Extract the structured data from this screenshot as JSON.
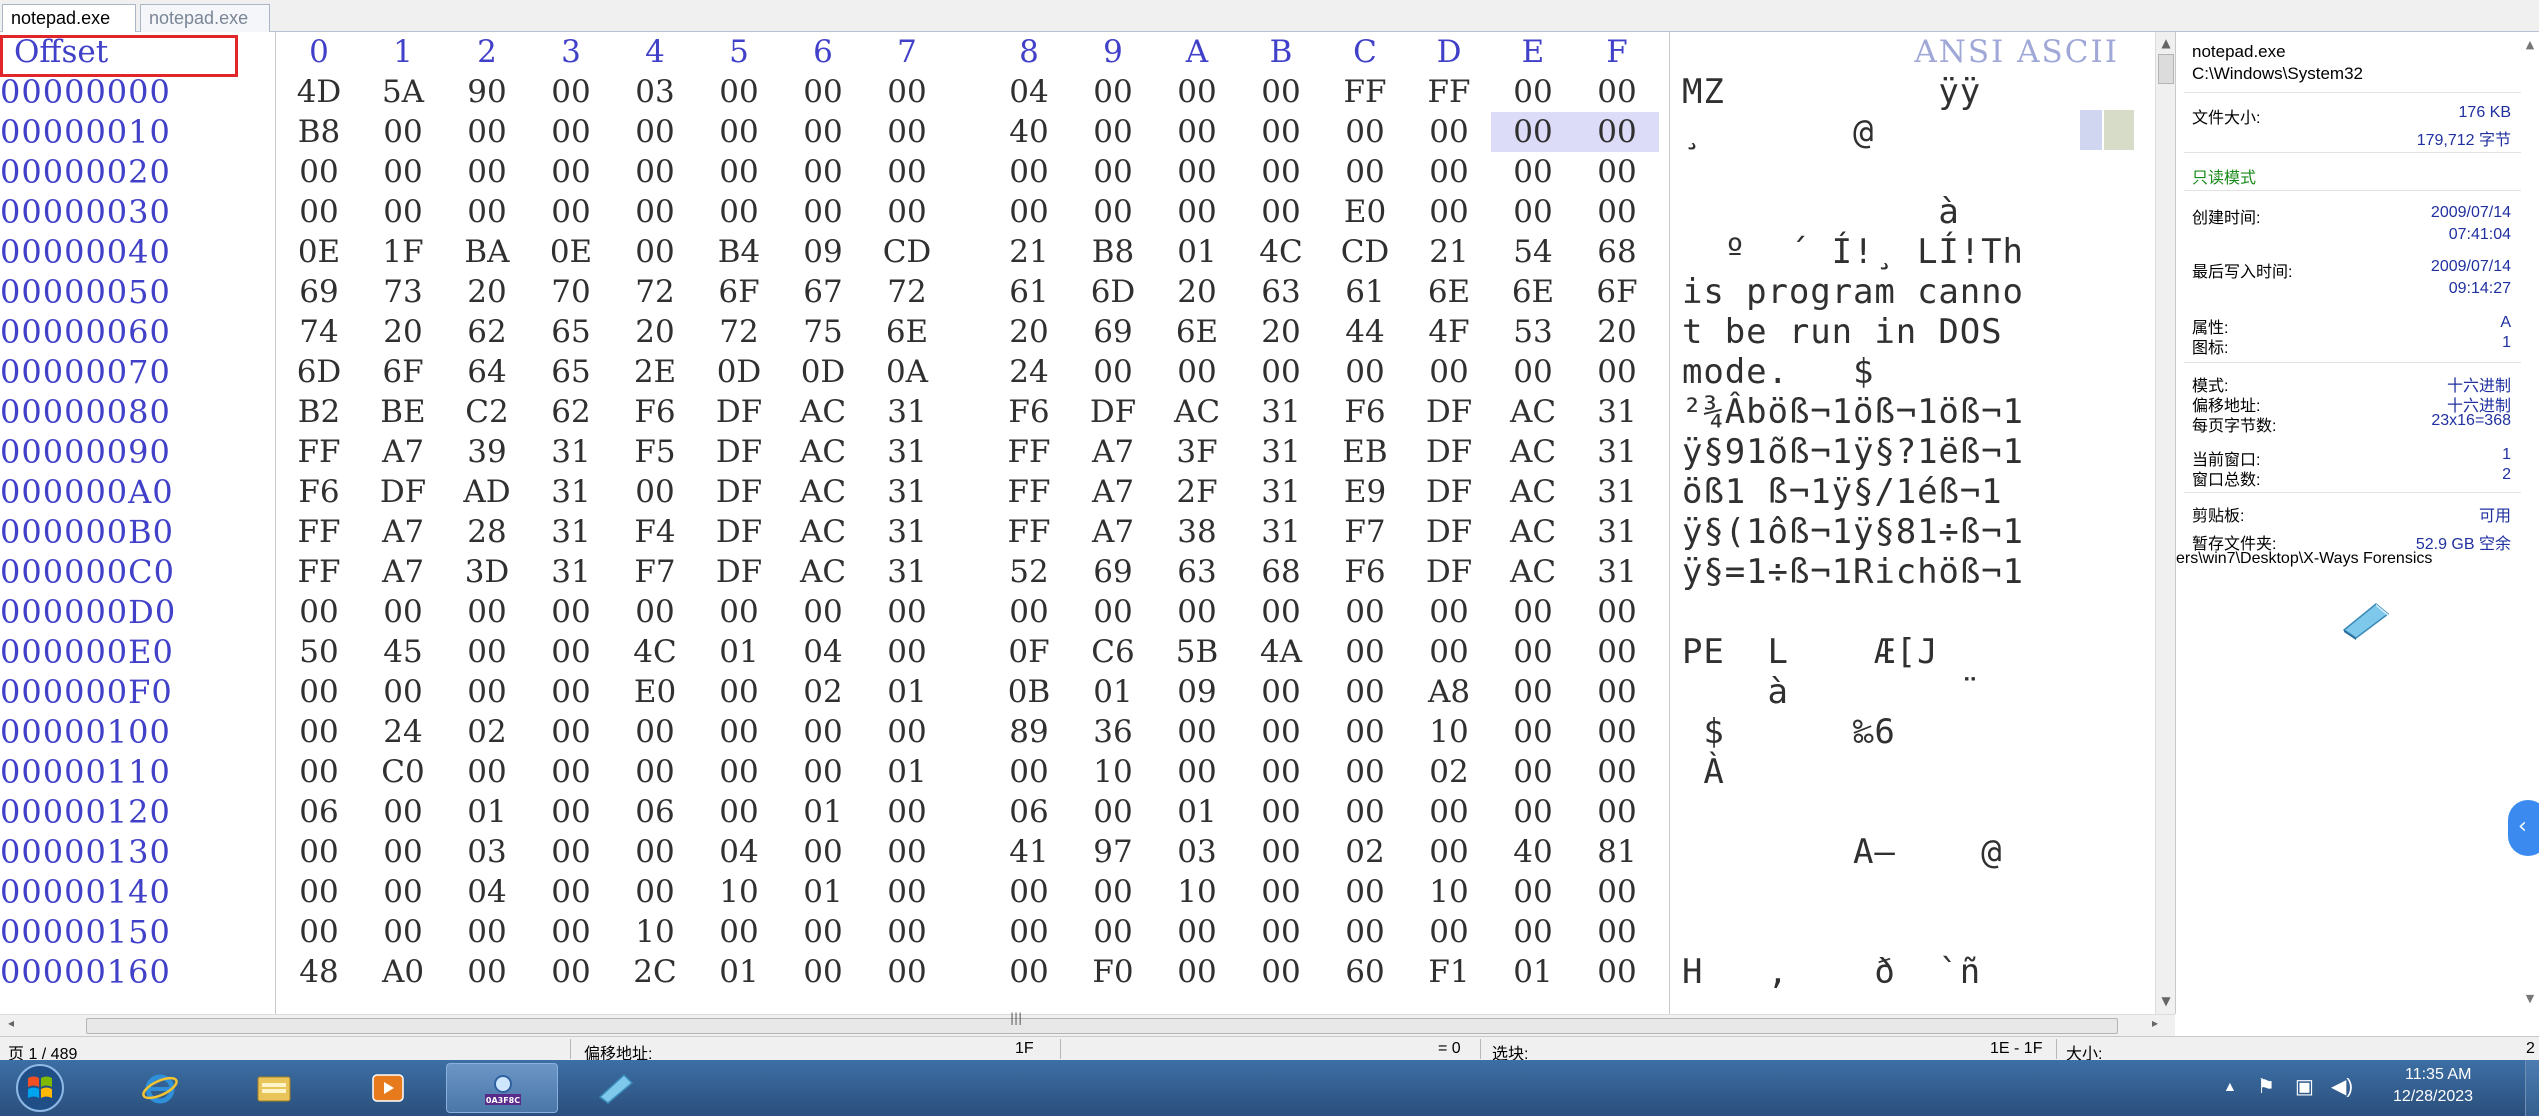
{
  "tabs": [
    {
      "label": "notepad.exe",
      "active": true
    },
    {
      "label": "notepad.exe",
      "active": false
    }
  ],
  "hex_header": {
    "offset_label": "Offset",
    "columns": [
      "0",
      "1",
      "2",
      "3",
      "4",
      "5",
      "6",
      "7",
      "8",
      "9",
      "A",
      "B",
      "C",
      "D",
      "E",
      "F"
    ],
    "ascii_label": "ANSI ASCII"
  },
  "rows": [
    {
      "offset": "00000000",
      "bytes": [
        "4D",
        "5A",
        "90",
        "00",
        "03",
        "00",
        "00",
        "00",
        "04",
        "00",
        "00",
        "00",
        "FF",
        "FF",
        "00",
        "00"
      ],
      "ascii": "MZ          ÿÿ  "
    },
    {
      "offset": "00000010",
      "bytes": [
        "B8",
        "00",
        "00",
        "00",
        "00",
        "00",
        "00",
        "00",
        "40",
        "00",
        "00",
        "00",
        "00",
        "00",
        "00",
        "00"
      ],
      "ascii": "¸       @       "
    },
    {
      "offset": "00000020",
      "bytes": [
        "00",
        "00",
        "00",
        "00",
        "00",
        "00",
        "00",
        "00",
        "00",
        "00",
        "00",
        "00",
        "00",
        "00",
        "00",
        "00"
      ],
      "ascii": "                "
    },
    {
      "offset": "00000030",
      "bytes": [
        "00",
        "00",
        "00",
        "00",
        "00",
        "00",
        "00",
        "00",
        "00",
        "00",
        "00",
        "00",
        "E0",
        "00",
        "00",
        "00"
      ],
      "ascii": "            à   "
    },
    {
      "offset": "00000040",
      "bytes": [
        "0E",
        "1F",
        "BA",
        "0E",
        "00",
        "B4",
        "09",
        "CD",
        "21",
        "B8",
        "01",
        "4C",
        "CD",
        "21",
        "54",
        "68"
      ],
      "ascii": "  º  ´ Í!¸ LÍ!Th"
    },
    {
      "offset": "00000050",
      "bytes": [
        "69",
        "73",
        "20",
        "70",
        "72",
        "6F",
        "67",
        "72",
        "61",
        "6D",
        "20",
        "63",
        "61",
        "6E",
        "6E",
        "6F"
      ],
      "ascii": "is program canno"
    },
    {
      "offset": "00000060",
      "bytes": [
        "74",
        "20",
        "62",
        "65",
        "20",
        "72",
        "75",
        "6E",
        "20",
        "69",
        "6E",
        "20",
        "44",
        "4F",
        "53",
        "20"
      ],
      "ascii": "t be run in DOS "
    },
    {
      "offset": "00000070",
      "bytes": [
        "6D",
        "6F",
        "64",
        "65",
        "2E",
        "0D",
        "0D",
        "0A",
        "24",
        "00",
        "00",
        "00",
        "00",
        "00",
        "00",
        "00"
      ],
      "ascii": "mode.   $       "
    },
    {
      "offset": "00000080",
      "bytes": [
        "B2",
        "BE",
        "C2",
        "62",
        "F6",
        "DF",
        "AC",
        "31",
        "F6",
        "DF",
        "AC",
        "31",
        "F6",
        "DF",
        "AC",
        "31"
      ],
      "ascii": "²¾Âböß¬1öß¬1öß¬1"
    },
    {
      "offset": "00000090",
      "bytes": [
        "FF",
        "A7",
        "39",
        "31",
        "F5",
        "DF",
        "AC",
        "31",
        "FF",
        "A7",
        "3F",
        "31",
        "EB",
        "DF",
        "AC",
        "31"
      ],
      "ascii": "ÿ§91õß¬1ÿ§?1ëß¬1"
    },
    {
      "offset": "000000A0",
      "bytes": [
        "F6",
        "DF",
        "AD",
        "31",
        "00",
        "DF",
        "AC",
        "31",
        "FF",
        "A7",
        "2F",
        "31",
        "E9",
        "DF",
        "AC",
        "31"
      ],
      "ascii": "öß­1 ß¬1ÿ§/1éß¬1"
    },
    {
      "offset": "000000B0",
      "bytes": [
        "FF",
        "A7",
        "28",
        "31",
        "F4",
        "DF",
        "AC",
        "31",
        "FF",
        "A7",
        "38",
        "31",
        "F7",
        "DF",
        "AC",
        "31"
      ],
      "ascii": "ÿ§(1ôß¬1ÿ§81÷ß¬1"
    },
    {
      "offset": "000000C0",
      "bytes": [
        "FF",
        "A7",
        "3D",
        "31",
        "F7",
        "DF",
        "AC",
        "31",
        "52",
        "69",
        "63",
        "68",
        "F6",
        "DF",
        "AC",
        "31"
      ],
      "ascii": "ÿ§=1÷ß¬1Richöß¬1"
    },
    {
      "offset": "000000D0",
      "bytes": [
        "00",
        "00",
        "00",
        "00",
        "00",
        "00",
        "00",
        "00",
        "00",
        "00",
        "00",
        "00",
        "00",
        "00",
        "00",
        "00"
      ],
      "ascii": "                "
    },
    {
      "offset": "000000E0",
      "bytes": [
        "50",
        "45",
        "00",
        "00",
        "4C",
        "01",
        "04",
        "00",
        "0F",
        "C6",
        "5B",
        "4A",
        "00",
        "00",
        "00",
        "00"
      ],
      "ascii": "PE  L    Æ[J    "
    },
    {
      "offset": "000000F0",
      "bytes": [
        "00",
        "00",
        "00",
        "00",
        "E0",
        "00",
        "02",
        "01",
        "0B",
        "01",
        "09",
        "00",
        "00",
        "A8",
        "00",
        "00"
      ],
      "ascii": "    à        ¨  "
    },
    {
      "offset": "00000100",
      "bytes": [
        "00",
        "24",
        "02",
        "00",
        "00",
        "00",
        "00",
        "00",
        "89",
        "36",
        "00",
        "00",
        "00",
        "10",
        "00",
        "00"
      ],
      "ascii": " $      ‰6      "
    },
    {
      "offset": "00000110",
      "bytes": [
        "00",
        "C0",
        "00",
        "00",
        "00",
        "00",
        "00",
        "01",
        "00",
        "10",
        "00",
        "00",
        "00",
        "02",
        "00",
        "00"
      ],
      "ascii": " À              "
    },
    {
      "offset": "00000120",
      "bytes": [
        "06",
        "00",
        "01",
        "00",
        "06",
        "00",
        "01",
        "00",
        "06",
        "00",
        "01",
        "00",
        "00",
        "00",
        "00",
        "00"
      ],
      "ascii": "                "
    },
    {
      "offset": "00000130",
      "bytes": [
        "00",
        "00",
        "03",
        "00",
        "00",
        "04",
        "00",
        "00",
        "41",
        "97",
        "03",
        "00",
        "02",
        "00",
        "40",
        "81"
      ],
      "ascii": "        A—    @ "
    },
    {
      "offset": "00000140",
      "bytes": [
        "00",
        "00",
        "04",
        "00",
        "00",
        "10",
        "01",
        "00",
        "00",
        "00",
        "10",
        "00",
        "00",
        "10",
        "00",
        "00"
      ],
      "ascii": "                "
    },
    {
      "offset": "00000150",
      "bytes": [
        "00",
        "00",
        "00",
        "00",
        "10",
        "00",
        "00",
        "00",
        "00",
        "00",
        "00",
        "00",
        "00",
        "00",
        "00",
        "00"
      ],
      "ascii": "                "
    },
    {
      "offset": "00000160",
      "bytes": [
        "48",
        "A0",
        "00",
        "00",
        "2C",
        "01",
        "00",
        "00",
        "00",
        "F0",
        "00",
        "00",
        "60",
        "F1",
        "01",
        "00"
      ],
      "ascii": "H   ,    ð  `ñ  "
    }
  ],
  "panel": {
    "file_name": "notepad.exe",
    "file_path": "C:\\Windows\\System32",
    "file_size_label": "文件大小:",
    "file_size_kb": "176 KB",
    "file_size_bytes": "179,712 字节",
    "readonly_mode": "只读模式",
    "created_label": "创建时间:",
    "created_date": "2009/07/14",
    "created_time": "07:41:04",
    "modified_label": "最后写入时间:",
    "modified_date": "2009/07/14",
    "modified_time": "09:14:27",
    "attr_label": "属性:",
    "attr_value": "A",
    "icon_label": "图标:",
    "icon_value": "1",
    "mode_label": "模式:",
    "mode_value": "十六进制",
    "offset_mode_label": "偏移地址:",
    "offset_mode_value": "十六进制",
    "bytes_per_page_label": "每页字节数:",
    "bytes_per_page_value": "23x16=368",
    "current_window_label": "当前窗口:",
    "current_window_value": "1",
    "window_count_label": "窗口总数:",
    "window_count_value": "2",
    "clipboard_label": "剪贴板:",
    "clipboard_value": "可用",
    "temp_label": "暂存文件夹:",
    "temp_value": "52.9 GB 空余",
    "temp_path": "ers\\win7\\Desktop\\X-Ways Forensics"
  },
  "status": {
    "page": "页 1 / 489",
    "offset_label": "偏移地址:",
    "offset_value": "1F",
    "eq_value": "= 0",
    "block_label": "选块:",
    "block_value": "1E - 1F",
    "size_label": "大小:",
    "size_value": "2"
  },
  "taskbar": {
    "clock_time": "11:35 AM",
    "clock_date": "12/28/2023"
  },
  "colors": {
    "offset_text": "#4040c8",
    "highlight_box": "#e0262a",
    "selected_bytes": "#dcdcf8",
    "readonly_green": "#1a8a1a"
  }
}
